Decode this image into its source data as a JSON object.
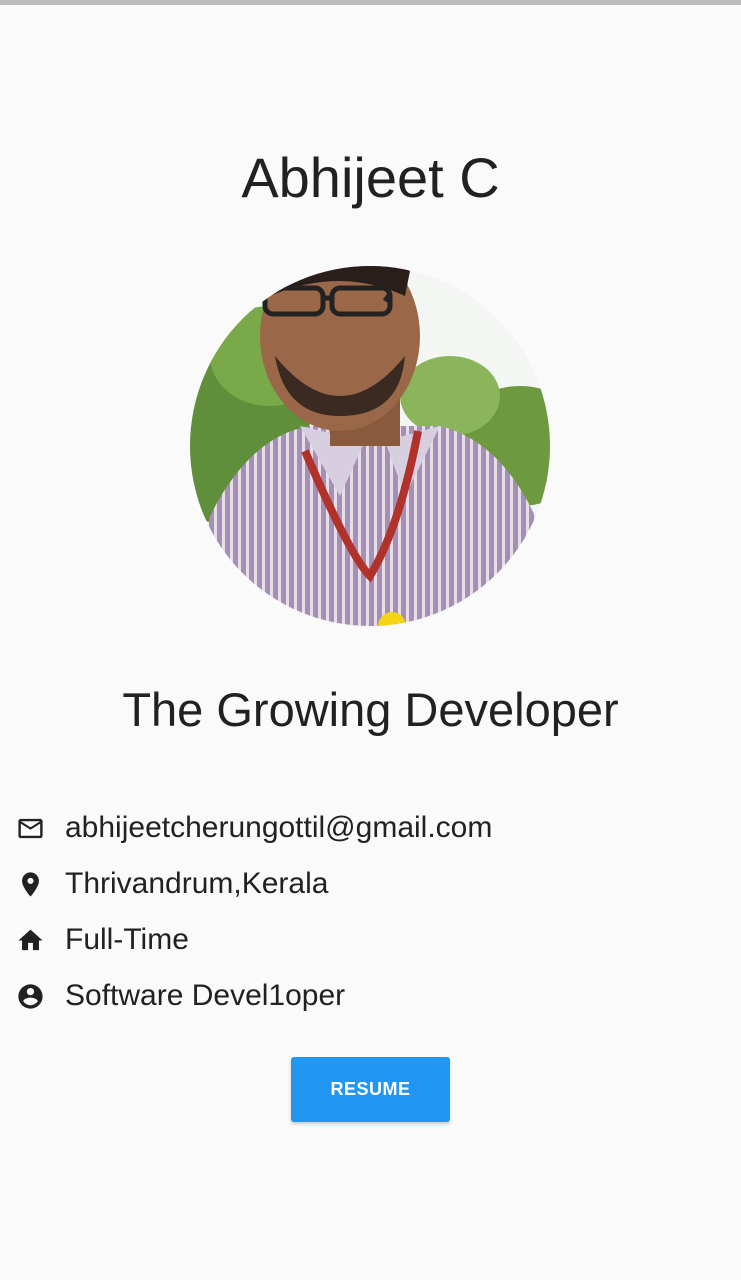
{
  "profile": {
    "name": "Abhijeet C",
    "tagline": "The Growing Developer"
  },
  "details": [
    {
      "icon": "mail-icon",
      "text": "abhijeetcherungottil@gmail.com"
    },
    {
      "icon": "location-pin-icon",
      "text": "Thrivandrum,Kerala"
    },
    {
      "icon": "home-icon",
      "text": "Full-Time"
    },
    {
      "icon": "account-circle-icon",
      "text": "Software Devel1oper"
    }
  ],
  "actions": {
    "resume_label": "RESUME"
  },
  "colors": {
    "background": "#fafafa",
    "button": "#2196f3",
    "button_text": "#ffffff",
    "text": "#212121"
  }
}
